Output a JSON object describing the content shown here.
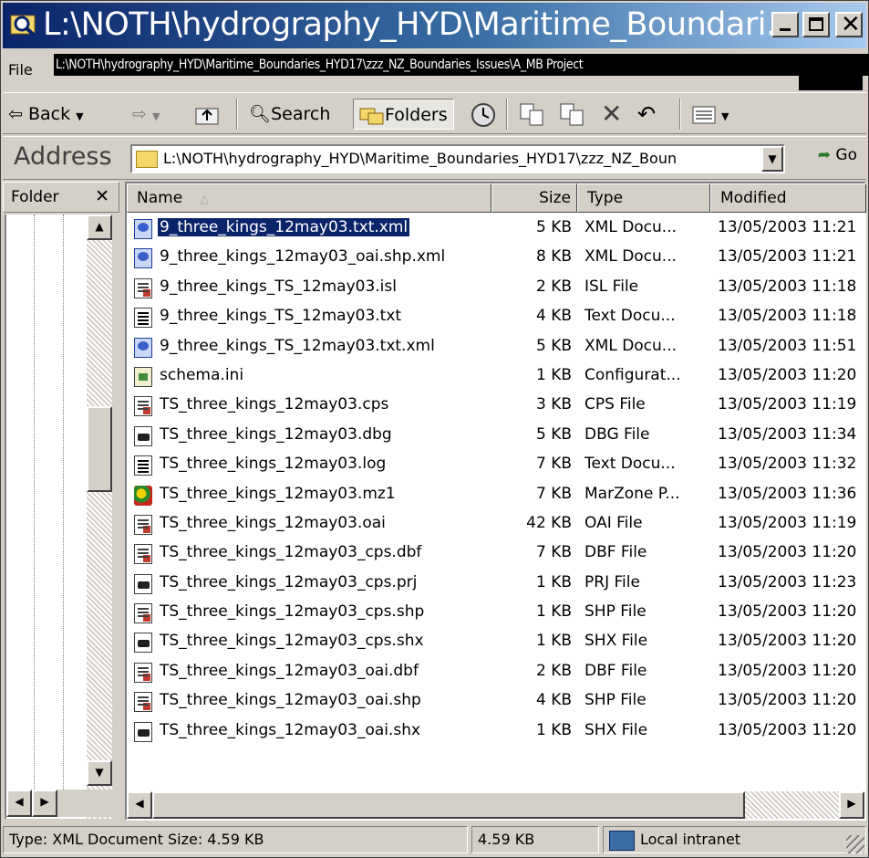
{
  "window": {
    "title": "L:\\NOTH\\hydrography_HYD\\Maritime_Boundari...",
    "tooltip": "L:\\NOTH\\hydrography_HYD\\Maritime_Boundaries_HYD17\\zzz_NZ_Boundaries_Issues\\A_MB Project",
    "menu_first": "File"
  },
  "toolbar": {
    "back": "⇦ Back",
    "search": "Search",
    "folders": "Folders"
  },
  "address": {
    "label": "Address",
    "value": "L:\\NOTH\\hydrography_HYD\\Maritime_Boundaries_HYD17\\zzz_NZ_Boun",
    "go": "Go"
  },
  "folder_pane": {
    "label": "Folder",
    "close": "✕"
  },
  "columns": {
    "name": "Name",
    "size": "Size",
    "type": "Type",
    "modified": "Modified"
  },
  "files": [
    {
      "icon": "xml-file-icon",
      "name": "9_three_kings_12may03.txt.xml",
      "size": "5 KB",
      "type": "XML Docu...",
      "modified": "13/05/2003 11:21",
      "selected": true
    },
    {
      "icon": "xml-file-icon",
      "name": "9_three_kings_12may03_oai.shp.xml",
      "size": "8 KB",
      "type": "XML Docu...",
      "modified": "13/05/2003 11:21"
    },
    {
      "icon": "generic-file-icon",
      "name": "9_three_kings_TS_12may03.isl",
      "size": "2 KB",
      "type": "ISL File",
      "modified": "13/05/2003 11:18"
    },
    {
      "icon": "text-file-icon",
      "name": "9_three_kings_TS_12may03.txt",
      "size": "4 KB",
      "type": "Text Docu...",
      "modified": "13/05/2003 11:18"
    },
    {
      "icon": "xml-file-icon",
      "name": "9_three_kings_TS_12may03.txt.xml",
      "size": "5 KB",
      "type": "XML Docu...",
      "modified": "13/05/2003 11:51"
    },
    {
      "icon": "ini-file-icon",
      "name": "schema.ini",
      "size": "1 KB",
      "type": "Configurat...",
      "modified": "13/05/2003 11:20"
    },
    {
      "icon": "generic-file-icon",
      "name": "TS_three_kings_12may03.cps",
      "size": "3 KB",
      "type": "CPS File",
      "modified": "13/05/2003 11:19"
    },
    {
      "icon": "system-file-icon",
      "name": "TS_three_kings_12may03.dbg",
      "size": "5 KB",
      "type": "DBG File",
      "modified": "13/05/2003 11:34"
    },
    {
      "icon": "text-file-icon",
      "name": "TS_three_kings_12may03.log",
      "size": "7 KB",
      "type": "Text Docu...",
      "modified": "13/05/2003 11:32"
    },
    {
      "icon": "marzone-file-icon",
      "name": "TS_three_kings_12may03.mz1",
      "size": "7 KB",
      "type": "MarZone P...",
      "modified": "13/05/2003 11:36"
    },
    {
      "icon": "generic-file-icon",
      "name": "TS_three_kings_12may03.oai",
      "size": "42 KB",
      "type": "OAI File",
      "modified": "13/05/2003 11:19"
    },
    {
      "icon": "generic-file-icon",
      "name": "TS_three_kings_12may03_cps.dbf",
      "size": "7 KB",
      "type": "DBF File",
      "modified": "13/05/2003 11:20"
    },
    {
      "icon": "system-file-icon",
      "name": "TS_three_kings_12may03_cps.prj",
      "size": "1 KB",
      "type": "PRJ File",
      "modified": "13/05/2003 11:23"
    },
    {
      "icon": "generic-file-icon",
      "name": "TS_three_kings_12may03_cps.shp",
      "size": "1 KB",
      "type": "SHP File",
      "modified": "13/05/2003 11:20"
    },
    {
      "icon": "system-file-icon",
      "name": "TS_three_kings_12may03_cps.shx",
      "size": "1 KB",
      "type": "SHX File",
      "modified": "13/05/2003 11:20"
    },
    {
      "icon": "generic-file-icon",
      "name": "TS_three_kings_12may03_oai.dbf",
      "size": "2 KB",
      "type": "DBF File",
      "modified": "13/05/2003 11:20"
    },
    {
      "icon": "generic-file-icon",
      "name": "TS_three_kings_12may03_oai.shp",
      "size": "4 KB",
      "type": "SHP File",
      "modified": "13/05/2003 11:20"
    },
    {
      "icon": "system-file-icon",
      "name": "TS_three_kings_12may03_oai.shx",
      "size": "1 KB",
      "type": "SHX File",
      "modified": "13/05/2003 11:20"
    }
  ],
  "status": {
    "info": "Type: XML Document Size: 4.59 KB",
    "size": "4.59 KB",
    "zone": "Local intranet"
  },
  "colors": {
    "title_start": "#0a246a",
    "title_end": "#a6caf0",
    "selection": "#0a246a",
    "chrome": "#d4d0c8"
  }
}
